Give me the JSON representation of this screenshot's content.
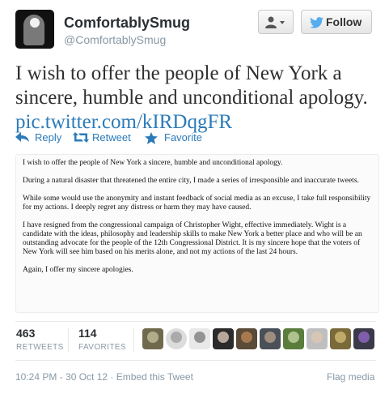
{
  "user": {
    "display_name": "ComfortablySmug",
    "screen_name": "@ComfortablySmug"
  },
  "header_buttons": {
    "user_menu_icon": "person-dropdown-icon",
    "follow_label": "Follow"
  },
  "tweet": {
    "text": "I wish to offer the people of New York a sincere, humble and unconditional apology.",
    "link": "pic.twitter.com/kIRDqgFR"
  },
  "actions": {
    "reply": "Reply",
    "retweet": "Retweet",
    "favorite": "Favorite"
  },
  "image_text": {
    "paragraphs": [
      "I wish to offer the people of New York a sincere, humble and unconditional apology.",
      "During a natural disaster that threatened the entire city, I made a series of irresponsible and inaccurate tweets.",
      "While some would use the anonymity and instant feedback of social media as an excuse, I take full responsibility for my actions.  I deeply regret any distress or harm they may have caused.",
      "I have resigned from the congressional campaign of Christopher Wight, effective immediately.  Wight is a candidate with the ideas, philosophy and leadership skills to make New York a better place and who will be an outstanding advocate for the people of the 12th Congressional District. It is my sincere hope that the voters of New York will see him based on his merits alone, and not my actions of the last 24 hours.",
      "Again, I offer my sincere apologies."
    ]
  },
  "stats": {
    "retweets_count": "463",
    "retweets_label": "RETWEETS",
    "favorites_count": "114",
    "favorites_label": "FAVORITES"
  },
  "footer": {
    "timestamp": "10:24 PM - 30 Oct 12",
    "separator": " · ",
    "embed": "Embed this Tweet",
    "flag": "Flag media"
  },
  "colors": {
    "link": "#2b7bb9",
    "follow_bird": "#55acee",
    "muted": "#8899a6"
  }
}
